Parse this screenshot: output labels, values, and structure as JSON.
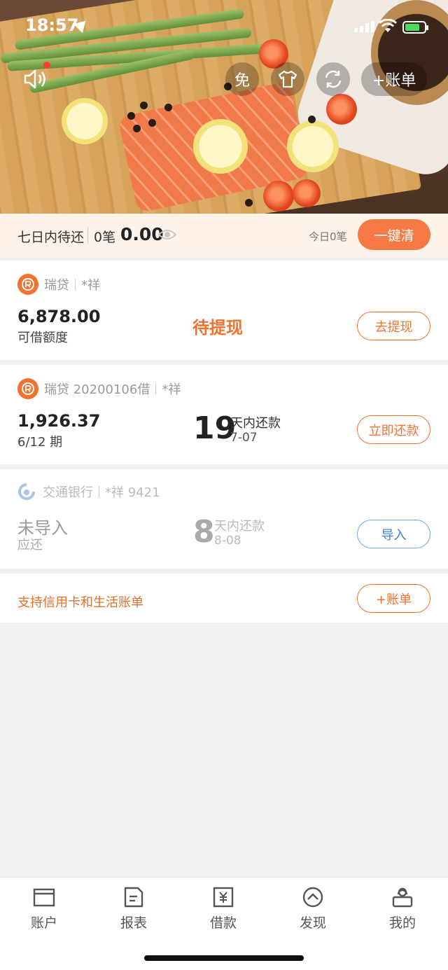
{
  "status_bar": {
    "time": "18:57"
  },
  "header": {
    "free_label": "免",
    "add_bill_label": "+账单"
  },
  "summary": {
    "label": "七日内待还",
    "count": "0笔",
    "amount": "0.00",
    "today": "今日0笔",
    "clear_button": "一键清"
  },
  "cards": [
    {
      "lender": "瑞贷",
      "holder": "*祥",
      "amount": "6,878.00",
      "amount_label": "可借额度",
      "status": "待提现",
      "action": "去提现"
    },
    {
      "lender": "瑞贷 20200106借",
      "holder": "*祥",
      "amount": "1,926.37",
      "amount_label": "6/12 期",
      "days": "19",
      "days_label": "天内还款",
      "due_date": "7-07",
      "action": "立即还款"
    },
    {
      "lender": "交通银行",
      "holder": "*祥 9421",
      "amount": "未导入",
      "amount_label": "应还",
      "days": "8",
      "days_label": "天内还款",
      "due_date": "8-08",
      "action": "导入"
    }
  ],
  "promo": {
    "text": "支持信用卡和生活账单",
    "button": "+账单"
  },
  "tabbar": {
    "items": [
      {
        "label": "账户",
        "icon": "wallet-icon"
      },
      {
        "label": "报表",
        "icon": "report-icon"
      },
      {
        "label": "借款",
        "icon": "loan-icon"
      },
      {
        "label": "发现",
        "icon": "discover-icon"
      },
      {
        "label": "我的",
        "icon": "profile-icon"
      }
    ]
  },
  "colors": {
    "accent": "#f27330",
    "clear_button": "#f77a45",
    "import_button": "#3b7fd0"
  }
}
